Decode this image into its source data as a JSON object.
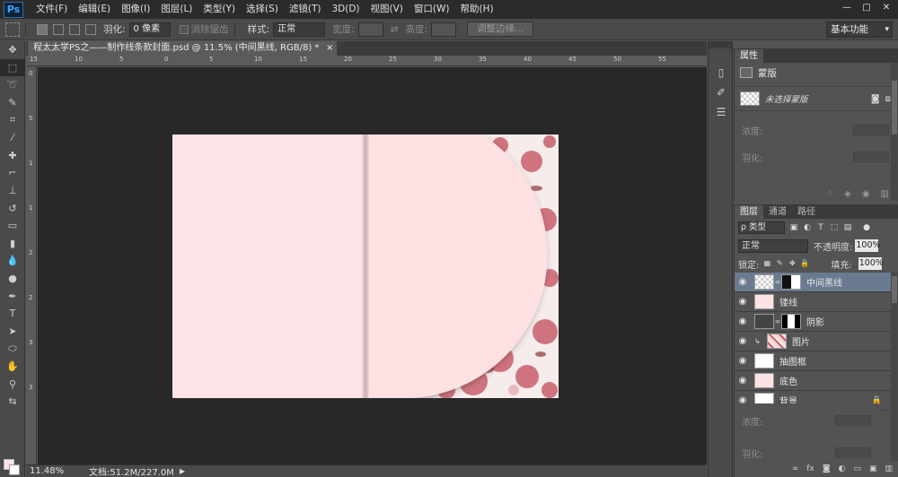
{
  "app": {
    "logo": "Ps",
    "menu": [
      "文件(F)",
      "编辑(E)",
      "图像(I)",
      "图层(L)",
      "类型(Y)",
      "选择(S)",
      "滤镜(T)",
      "3D(D)",
      "视图(V)",
      "窗口(W)",
      "帮助(H)"
    ],
    "window_controls": [
      "—",
      "□",
      "✕"
    ]
  },
  "options": {
    "feather_label": "羽化:",
    "feather_value": "0 像素",
    "antialias_label": "消除锯齿",
    "style_label": "样式:",
    "style_value": "正常",
    "width_label": "宽度:",
    "height_label": "高度:",
    "refine_edge": "调整边缘...",
    "workspace": "基本功能"
  },
  "document": {
    "tab_title": "程太太学PS之——制作线条款封面.psd @ 11.5% (中间黑线, RGB/8) *",
    "close": "×",
    "ruler_top": [
      "15",
      "10",
      "5",
      "0",
      "5",
      "10",
      "15",
      "20",
      "25",
      "30",
      "35",
      "40",
      "45",
      "50",
      "55"
    ],
    "ruler_left": [
      "0",
      "5",
      "1",
      "1",
      "2",
      "2",
      "3",
      "3"
    ],
    "canvas_bg": "#282828",
    "paper_color": "#fde3e5"
  },
  "status": {
    "zoom": "11.48%",
    "doc_info": "文档:51.2M/227.0M",
    "arrow": "▶"
  },
  "properties": {
    "tab": "属性",
    "title": "蒙版",
    "mask_label": "未选择蒙版",
    "density_label": "浓度:",
    "feather_label": "羽化:"
  },
  "layers": {
    "tabs": [
      "图层",
      "通道",
      "路径"
    ],
    "kind": "ρ 类型",
    "blend_mode": "正常",
    "opacity_label": "不透明度:",
    "opacity_value": "100%",
    "lock_label": "锁定:",
    "fill_label": "填充:",
    "fill_value": "100%",
    "items": [
      {
        "name": "中间黑线",
        "thumb": "checker",
        "mask": "half",
        "selected": true
      },
      {
        "name": "镂线",
        "thumb": "pink",
        "mask": "",
        "selected": false
      },
      {
        "name": "阴影",
        "thumb": "checker",
        "mask": "center",
        "selected": false
      },
      {
        "name": "图片",
        "thumb": "floral",
        "mask": "",
        "selected": false
      },
      {
        "name": "抽图框",
        "thumb": "white",
        "mask": "",
        "selected": false
      },
      {
        "name": "底色",
        "thumb": "pink",
        "mask": "",
        "selected": false
      },
      {
        "name": "背景",
        "thumb": "white",
        "mask": "",
        "selected": false
      }
    ],
    "overlay_density": "浓度:",
    "overlay_feather": "羽化:"
  }
}
